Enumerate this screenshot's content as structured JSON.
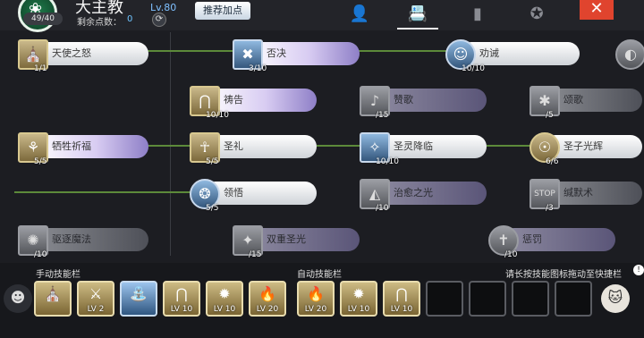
{
  "header": {
    "class_name": "大主教",
    "emblem_glyph": "❀",
    "points": "49/40",
    "remain_label": "剩余点数：",
    "remain_value": "0",
    "level": "Lv.80",
    "recommend_label": "推荐加点",
    "refresh_glyph": "⟳",
    "close_glyph": "✕",
    "tabs": [
      {
        "icon": "person-gear-icon",
        "glyph": "👤"
      },
      {
        "icon": "contact-book-icon",
        "glyph": "📇"
      },
      {
        "icon": "book-icon",
        "glyph": "▮"
      },
      {
        "icon": "crest-icon",
        "glyph": "✪"
      }
    ]
  },
  "skills": [
    {
      "name": "天使之怒",
      "count": "1/1",
      "glyph": "⛪",
      "style": "white"
    },
    {
      "name": "否决",
      "count": "3/10",
      "glyph": "✖",
      "style": "purple",
      "icon": "blue"
    },
    {
      "name": "劝诫",
      "count": "10/10",
      "glyph": "☺",
      "style": "white",
      "icon": "blue round"
    },
    {
      "name": "",
      "count": "",
      "glyph": "◐",
      "style": "white",
      "icon": "gray round"
    },
    {
      "name": "祷告",
      "count": "10/10",
      "glyph": "⋂",
      "style": "purple"
    },
    {
      "name": "赞歌",
      "count": "/15",
      "glyph": "♪",
      "style": "dimpurple",
      "icon": "gray"
    },
    {
      "name": "颂歌",
      "count": "/5",
      "glyph": "✱",
      "style": "dim",
      "icon": "gray"
    },
    {
      "name": "牺牲祈福",
      "count": "5/5",
      "glyph": "⚘",
      "style": "purple"
    },
    {
      "name": "圣礼",
      "count": "5/5",
      "glyph": "☥",
      "style": "white"
    },
    {
      "name": "圣灵降临",
      "count": "10/10",
      "glyph": "✧",
      "style": "white",
      "icon": "blue"
    },
    {
      "name": "圣子光辉",
      "count": "6/6",
      "glyph": "☉",
      "style": "white",
      "icon": "round"
    },
    {
      "name": "领悟",
      "count": "5/5",
      "glyph": "❂",
      "style": "white",
      "icon": "blue round"
    },
    {
      "name": "治愈之光",
      "count": "/10",
      "glyph": "◭",
      "style": "dimpurple",
      "icon": "gray"
    },
    {
      "name": "缄默术",
      "count": "/3",
      "glyph": "STOP",
      "style": "dim",
      "icon": "gray"
    },
    {
      "name": "驱逐魔法",
      "count": "/10",
      "glyph": "✺",
      "style": "dim",
      "icon": "gray"
    },
    {
      "name": "双重圣光",
      "count": "/15",
      "glyph": "✦",
      "style": "dimpurple",
      "icon": "gray"
    },
    {
      "name": "惩罚",
      "count": "/10",
      "glyph": "✝",
      "style": "dimpurple",
      "icon": "gray round"
    }
  ],
  "bottom": {
    "manual_label": "手动技能栏",
    "auto_label": "自动技能栏",
    "hint": "请长按技能图标拖动至快捷栏",
    "info_glyph": "!",
    "manual_slots": [
      {
        "glyph": "⛪",
        "lv": ""
      },
      {
        "glyph": "⚔",
        "lv": "LV 2"
      },
      {
        "glyph": "⛲",
        "lv": "",
        "blue": true
      },
      {
        "glyph": "⋂",
        "lv": "LV 10"
      },
      {
        "glyph": "✹",
        "lv": "LV 10"
      },
      {
        "glyph": "🔥",
        "lv": "LV 20"
      }
    ],
    "auto_slots": [
      {
        "glyph": "🔥",
        "lv": "LV 20"
      },
      {
        "glyph": "✹",
        "lv": "LV 10"
      },
      {
        "glyph": "⋂",
        "lv": "LV 10"
      },
      {
        "glyph": "",
        "lv": "",
        "empty": true
      },
      {
        "glyph": "",
        "lv": "",
        "empty": true
      },
      {
        "glyph": "",
        "lv": "",
        "empty": true
      },
      {
        "glyph": "",
        "lv": "",
        "empty": true
      }
    ],
    "left_face": "☻",
    "right_face": "🐱"
  }
}
